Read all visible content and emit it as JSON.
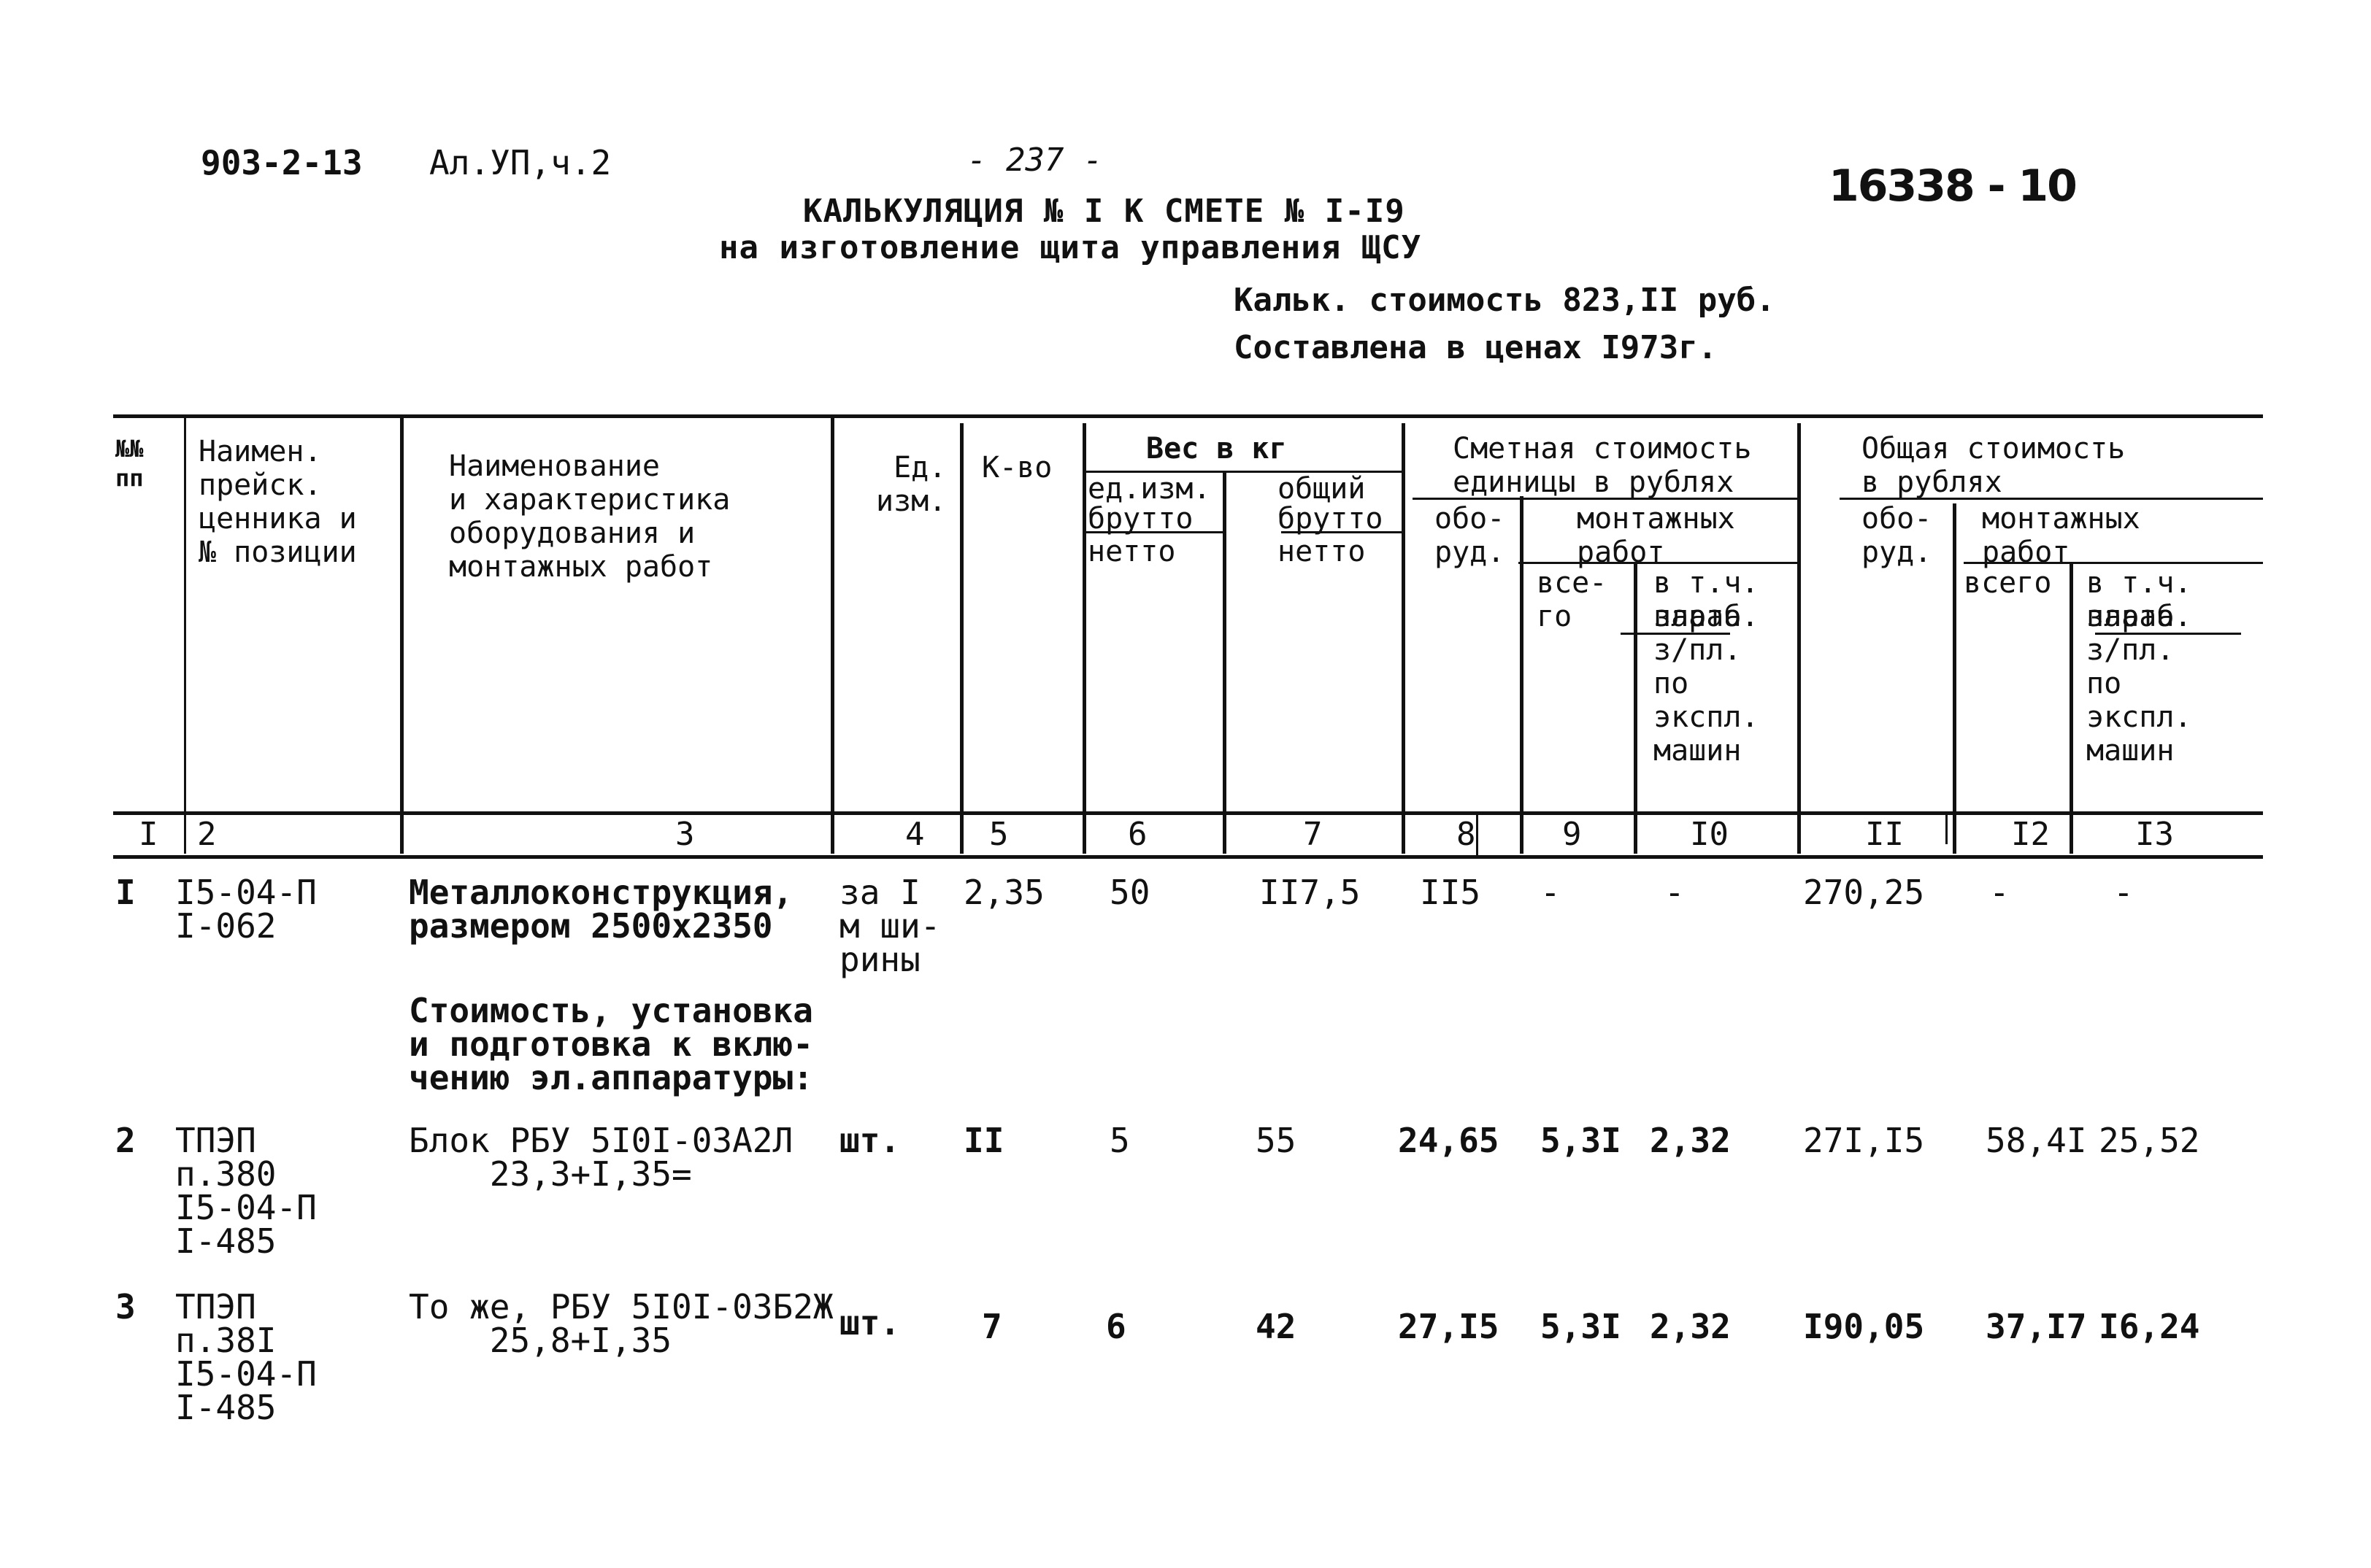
{
  "document": {
    "project_code": "903-2-13",
    "album": "Ал.УП,ч.2",
    "page_number": "- 237 -",
    "archive_number": "16338 - 10",
    "title_line1": "КАЛЬКУЛЯЦИЯ № I К СМЕТЕ № I-I9",
    "title_line2": "на изготовление щита управления ЩСУ",
    "calc_cost": "Кальк. стоимость 823,II руб.",
    "price_basis": "Составлена в ценах I973г."
  },
  "table": {
    "headers": {
      "col1": "№№\nпп",
      "col2": "Наимен.\nпрейск.\nценника и\n№ позиции",
      "col3": "Наименование\nи характеристика\nоборудования и\nмонтажных работ",
      "col4": "Ед.\nизм.",
      "col5": "К-во",
      "weight_group": "Вес в кг",
      "col6_top": "ед.изм.",
      "col6_mid": "брутто",
      "col6_bot": "нетто",
      "col7_top": "общий",
      "col7_mid": "брутто",
      "col7_bot": "нетто",
      "unit_cost_group": "Сметная стоимость\nединицы в рублях",
      "col8": "обо-\nруд.",
      "unit_install_group": "монтажных\nработ",
      "col9": "все-\nго",
      "col10_a": "в т.ч.\nзараб.",
      "col10_b": "плата",
      "col10_c": "з/пл.\nпо\nэкспл.\nмашин",
      "total_cost_group": "Общая стоимость\nв рублях",
      "col11": "обо-\nруд.",
      "total_install_group": "монтажных\nработ",
      "col12": "всего",
      "col13_a": "в т.ч.\nзараб.",
      "col13_b": "плата",
      "col13_c": "з/пл.\nпо\nэкспл.\nмашин"
    },
    "column_numbers": [
      "I",
      "2",
      "3",
      "4",
      "5",
      "6",
      "7",
      "8",
      "9",
      "I0",
      "II",
      "I2",
      "I3"
    ],
    "rows": [
      {
        "num": "I",
        "pricelist": "I5-04-П\nI-062",
        "name": "Металлоконструкция,\nразмером 2500х2350",
        "unit": "за I\nм ши-\nрины",
        "qty": "2,35",
        "weight_unit": "50",
        "weight_total": "II7,5",
        "unit_equip": "II5",
        "unit_install_total": "-",
        "unit_install_wage": "-",
        "total_equip": "270,25",
        "total_install": "-",
        "total_wage": "-"
      },
      {
        "section_note": "Стоимость, установка\nи подготовка к вклю-\nчению эл.аппаратуры:"
      },
      {
        "num": "2",
        "pricelist": "ТПЭП\nп.380\nI5-04-П\nI-485",
        "name": "Блок РБУ 5I0I-03А2Л\n    23,3+I,35=",
        "unit": "шт.",
        "qty": "II",
        "weight_unit": "5",
        "weight_total": "55",
        "unit_equip": "24,65",
        "unit_install_total": "5,3I",
        "unit_install_wage": "2,32",
        "total_equip": "27I,I5",
        "total_install": "58,4I",
        "total_wage": "25,52"
      },
      {
        "num": "3",
        "pricelist": "ТПЭП\nп.38I\nI5-04-П\nI-485",
        "name": "То же, РБУ 5I0I-03Б2Ж\n    25,8+I,35",
        "unit": "шт.",
        "qty": "7",
        "weight_unit": "6",
        "weight_total": "42",
        "unit_equip": "27,I5",
        "unit_install_total": "5,3I",
        "unit_install_wage": "2,32",
        "total_equip": "I90,05",
        "total_install": "37,I7",
        "total_wage": "I6,24"
      }
    ]
  }
}
